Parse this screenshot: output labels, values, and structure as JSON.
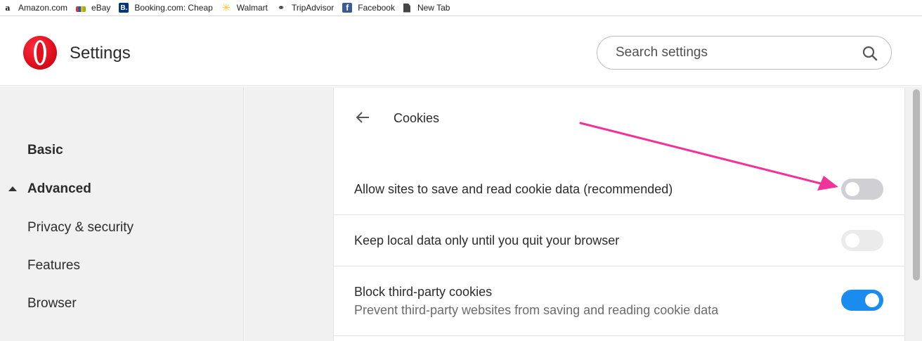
{
  "bookmarks": [
    {
      "label": "Amazon.com",
      "icon": "amazon-icon"
    },
    {
      "label": "eBay",
      "icon": "ebay-icon"
    },
    {
      "label": "Booking.com: Cheap",
      "icon": "booking-icon"
    },
    {
      "label": "Walmart",
      "icon": "walmart-icon"
    },
    {
      "label": "TripAdvisor",
      "icon": "tripadvisor-icon"
    },
    {
      "label": "Facebook",
      "icon": "facebook-icon"
    },
    {
      "label": "New Tab",
      "icon": "page-icon"
    }
  ],
  "header": {
    "title": "Settings",
    "search_placeholder": "Search settings"
  },
  "sidebar": {
    "items": [
      {
        "label": "Basic"
      },
      {
        "label": "Advanced"
      },
      {
        "label": "Privacy & security"
      },
      {
        "label": "Features"
      },
      {
        "label": "Browser"
      }
    ]
  },
  "cookies": {
    "title": "Cookies",
    "rows": [
      {
        "label": "Allow sites to save and read cookie data (recommended)",
        "state": "off"
      },
      {
        "label": "Keep local data only until you quit your browser",
        "state": "disabled"
      },
      {
        "label": "Block third-party cookies",
        "sublabel": "Prevent third-party websites from saving and reading cookie data",
        "state": "on"
      }
    ]
  },
  "colors": {
    "accent": "#1a8cf0",
    "annotation": "#f0339b",
    "brand": "#e0101f"
  }
}
